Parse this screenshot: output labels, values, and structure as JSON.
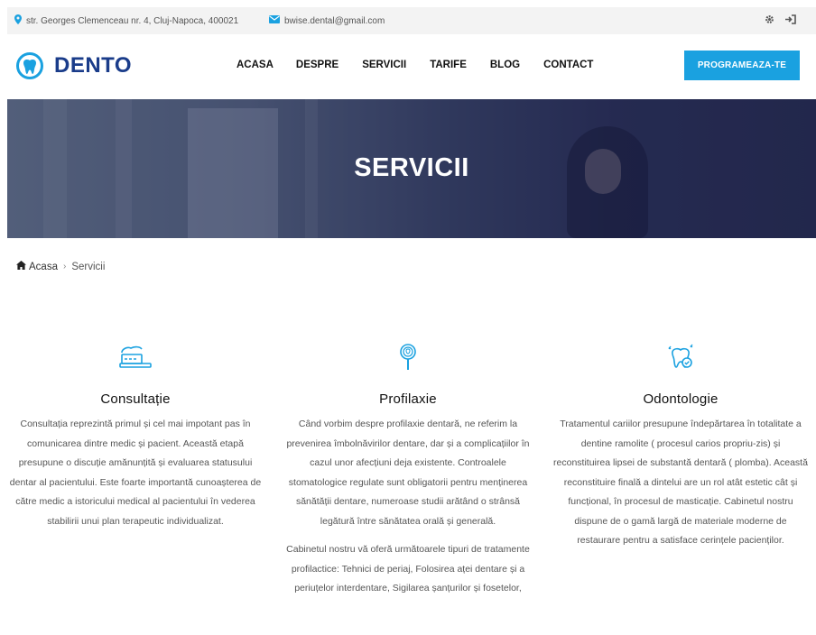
{
  "topbar": {
    "address": "str. Georges Clemenceau nr. 4, Cluj-Napoca, 400021",
    "email": "bwise.dental@gmail.com",
    "address_icon": "map-marker-icon",
    "email_icon": "envelope-icon",
    "settings_icon": "gear-icon",
    "login_icon": "sign-in-icon"
  },
  "header": {
    "logo_text": "DENTO",
    "logo_icon": "tooth-icon",
    "nav": [
      "ACASA",
      "DESPRE",
      "SERVICII",
      "TARIFE",
      "BLOG",
      "CONTACT"
    ],
    "cta_label": "PROGRAMEAZA-TE"
  },
  "hero": {
    "title": "SERVICII"
  },
  "breadcrumb": {
    "home": "Acasa",
    "separator": "›",
    "current": "Servicii"
  },
  "services": [
    {
      "icon": "toothpaste-icon",
      "title": "Consultație",
      "paragraphs": [
        "Consultația reprezintă primul și cel mai impotant pas în comunicarea dintre medic și pacient. Această etapă presupune o discuție amănunțită și evaluarea statusului dentar al pacientului. Este foarte importantă cunoașterea de către medic a istoricului medical al pacientului în vederea stabilirii unui plan terapeutic individualizat."
      ]
    },
    {
      "icon": "dental-mirror-icon",
      "title": "Profilaxie",
      "paragraphs": [
        "Când vorbim despre profilaxie dentară, ne referim la prevenirea îmbolnăvirilor dentare, dar și a complicațiilor în cazul unor afecțiuni deja existente. Controalele stomatologice regulate sunt obligatorii pentru menținerea sănătății dentare, numeroase studii arătând o strânsă legătură între sănătatea orală și generală.",
        "Cabinetul nostru vă oferă următoarele tipuri de tratamente profilactice: Tehnici de periaj, Folosirea aței dentare și a periuțelor interdentare, Sigilarea șanțurilor și fosetelor,"
      ]
    },
    {
      "icon": "tooth-check-icon",
      "title": "Odontologie",
      "paragraphs": [
        "Tratamentul cariilor presupune îndepărtarea în totalitate a dentine ramolite ( procesul carios propriu-zis) și reconstituirea lipsei de substantă dentară ( plomba). Această reconstituire finală a dintelui are un rol atât estetic cât și funcțional, în procesul de masticație. Cabinetul nostru dispune de o gamă largă de materiale moderne de restaurare pentru a satisface cerințele pacienților."
      ]
    }
  ],
  "colors": {
    "accent": "#1aa1e0",
    "brand": "#1a3c8a",
    "hero_overlay": "#2a2f55"
  }
}
